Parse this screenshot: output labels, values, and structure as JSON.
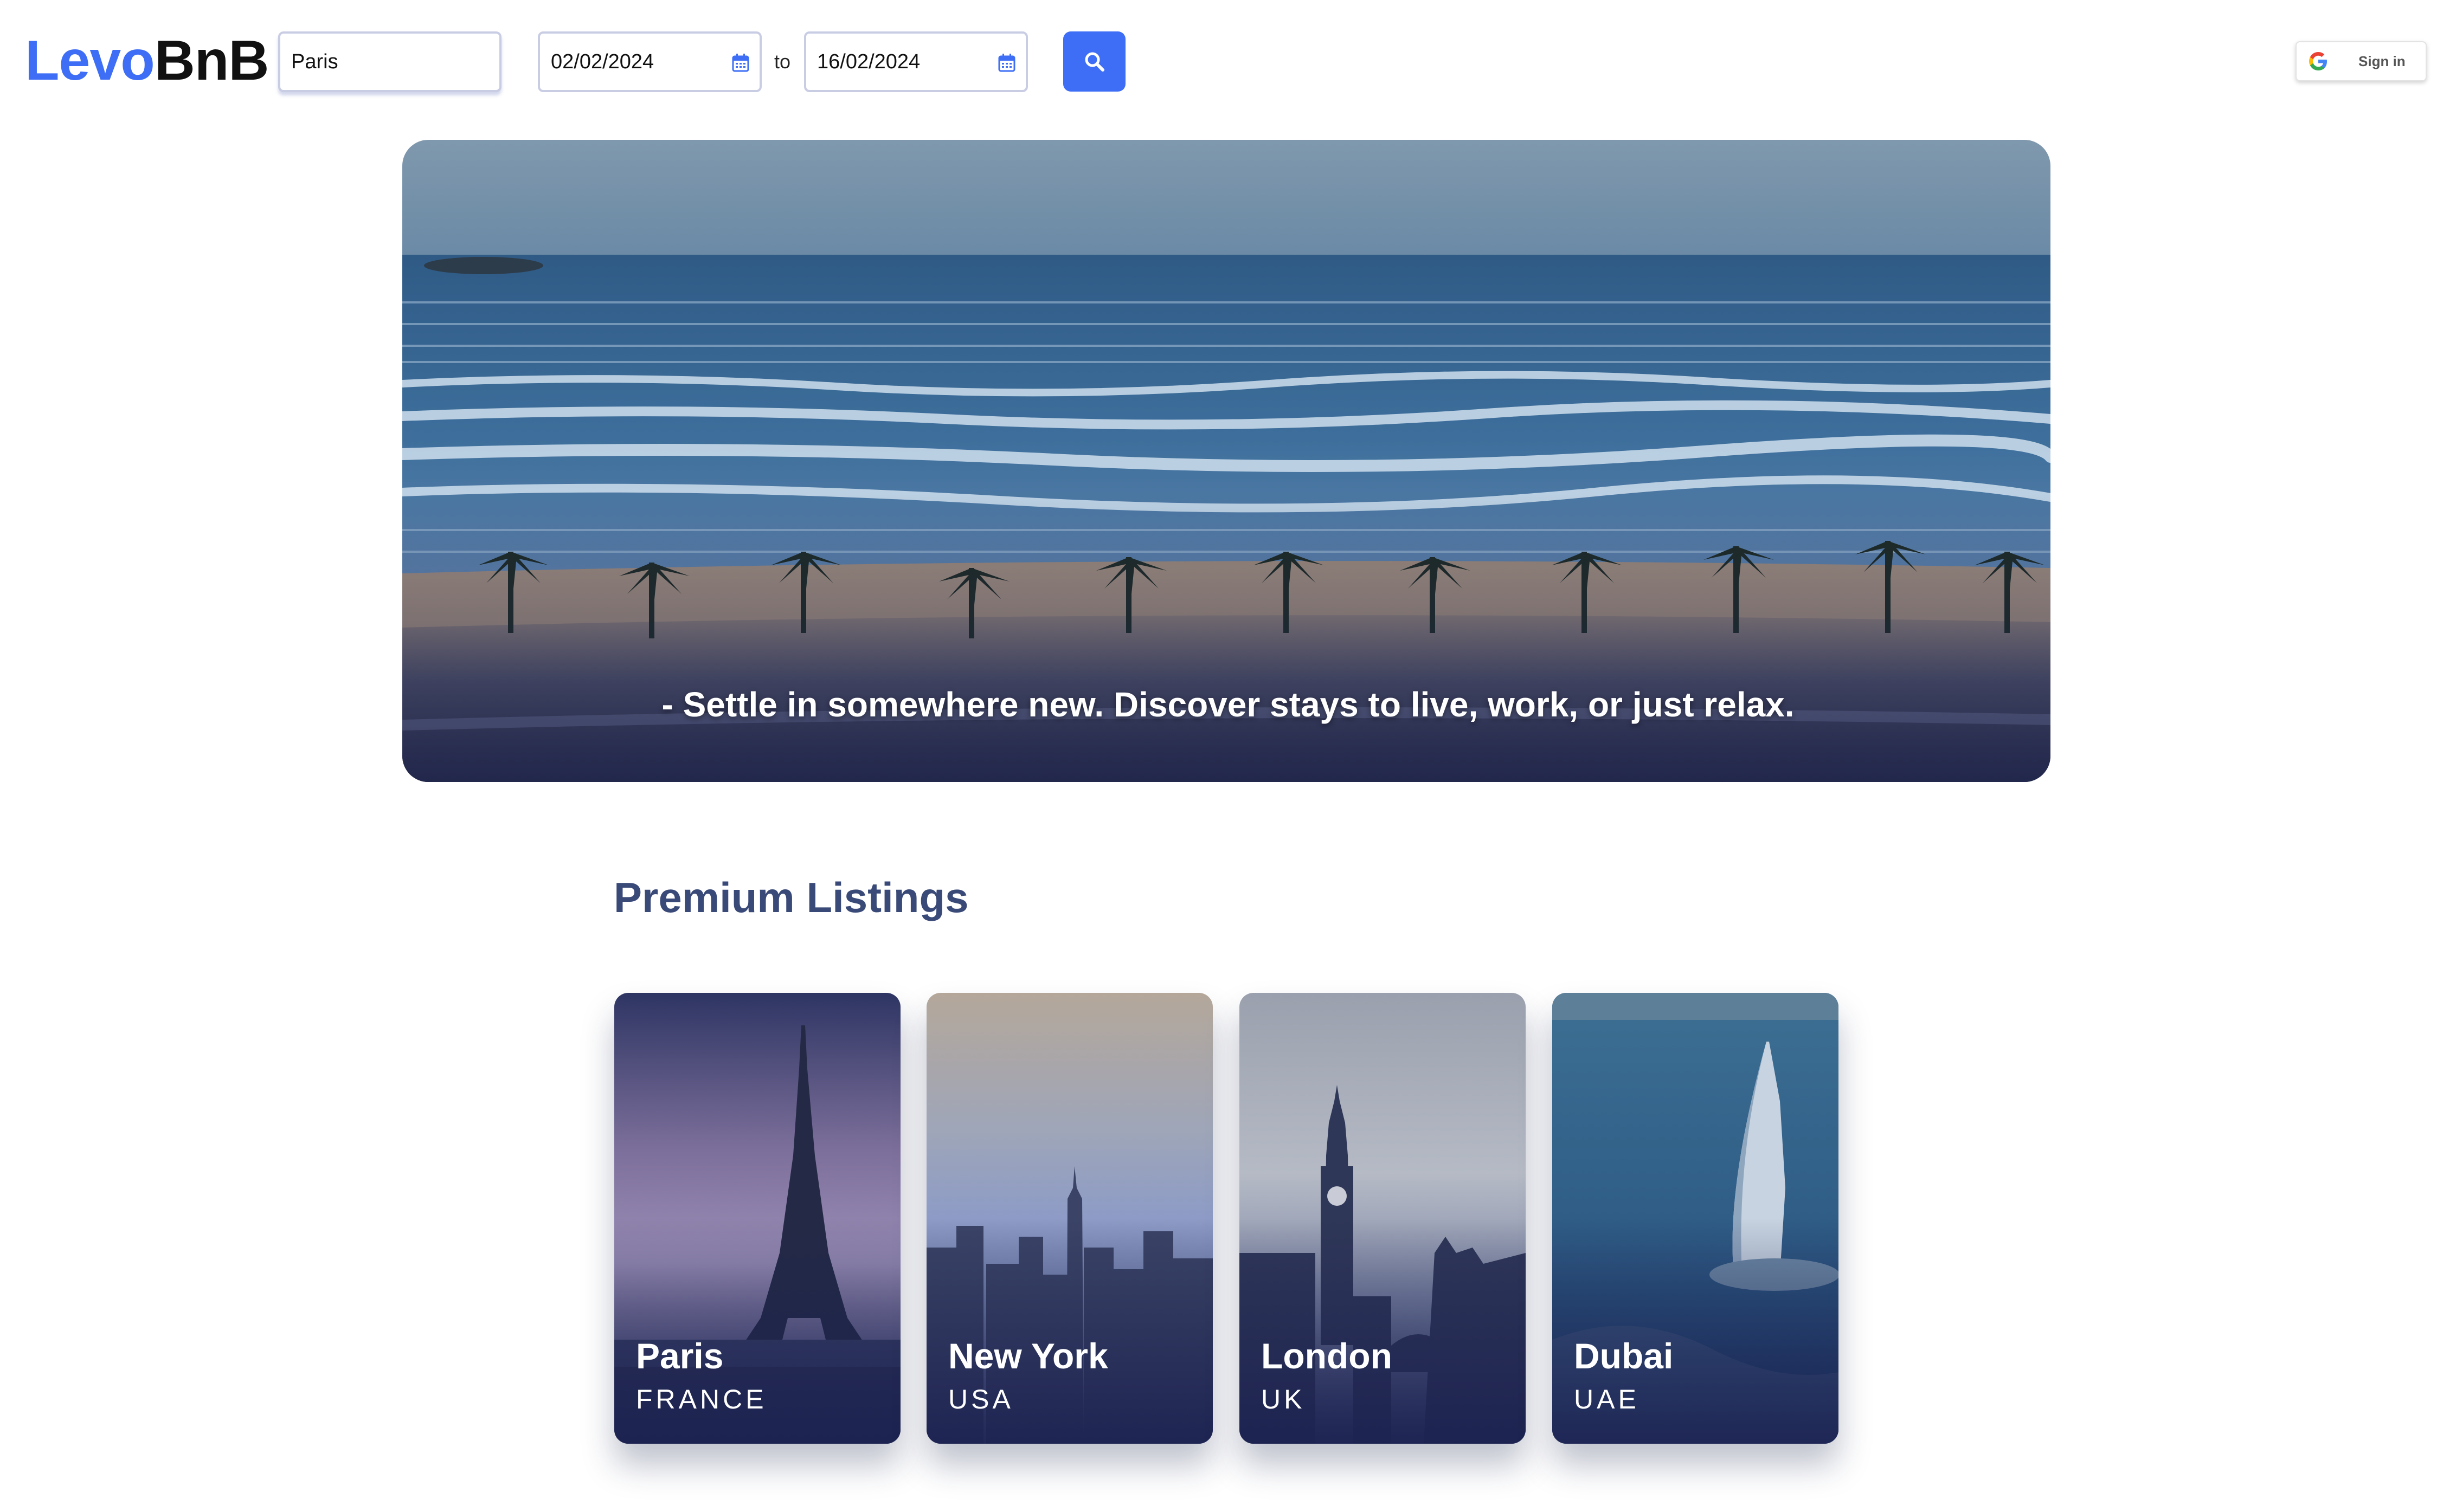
{
  "header": {
    "logo_part1": "Levo",
    "logo_part2": "BnB",
    "location_value": "Paris",
    "check_in_value": "02/02/2024",
    "separator": "to",
    "check_out_value": "16/02/2024",
    "search_icon": "search-icon",
    "signin_label": "Sign in",
    "signin_icon": "google-icon"
  },
  "hero": {
    "caption": "- Settle in somewhere new. Discover stays to live, work, or just relax."
  },
  "listings": {
    "title": "Premium Listings",
    "cards": [
      {
        "city": "Paris",
        "country": "FRANCE"
      },
      {
        "city": "New York",
        "country": "USA"
      },
      {
        "city": "London",
        "country": "UK"
      },
      {
        "city": "Dubai",
        "country": "UAE"
      }
    ]
  },
  "colors": {
    "brand_blue": "#3d6ef5",
    "heading": "#3a4a78",
    "logo_dark": "#111111"
  }
}
